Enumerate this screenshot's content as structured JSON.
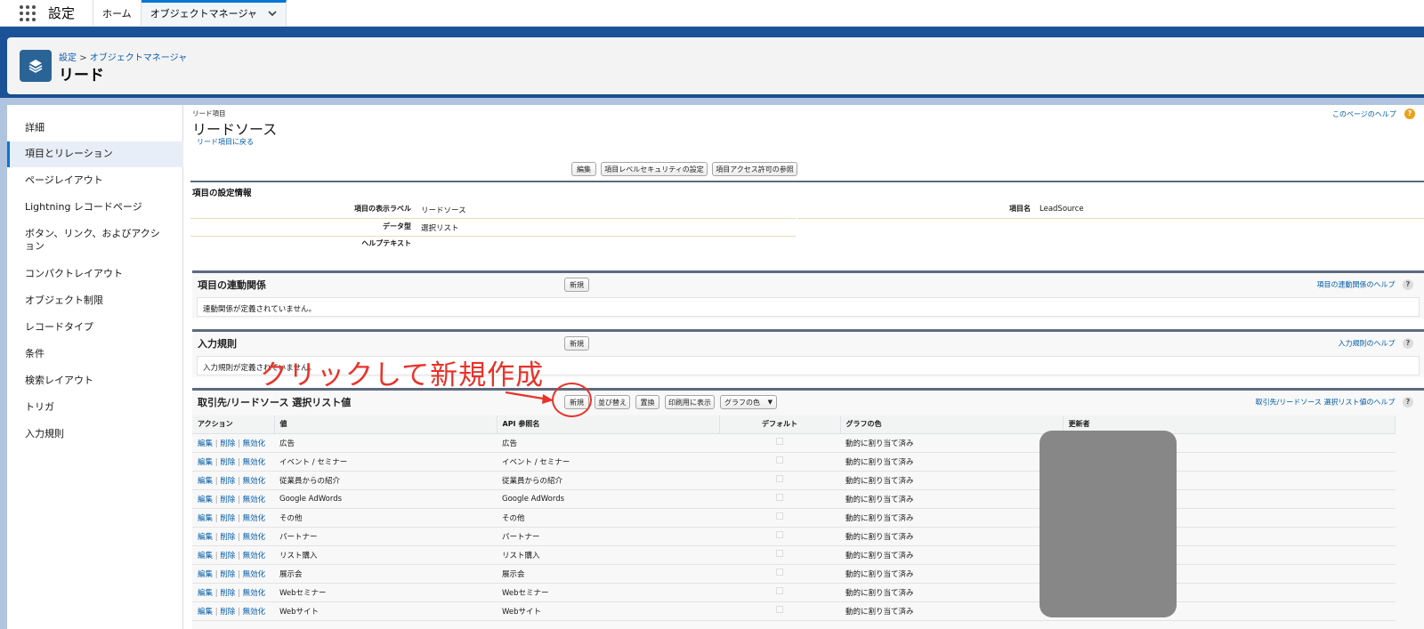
{
  "nav": {
    "app_name": "設定",
    "home_tab": "ホーム",
    "object_tab": "オブジェクトマネージャ"
  },
  "header": {
    "crumb_setup": "設定",
    "crumb_sep": ">",
    "crumb_object_manager": "オブジェクトマネージャ",
    "title": "リード"
  },
  "sidebar": {
    "items": [
      {
        "label": "詳細"
      },
      {
        "label": "項目とリレーション"
      },
      {
        "label": "ページレイアウト"
      },
      {
        "label": "Lightning レコードページ"
      },
      {
        "label": "ボタン、リンク、およびアクション"
      },
      {
        "label": "コンパクトレイアウト"
      },
      {
        "label": "オブジェクト制限"
      },
      {
        "label": "レコードタイプ"
      },
      {
        "label": "条件"
      },
      {
        "label": "検索レイアウト"
      },
      {
        "label": "トリガ"
      },
      {
        "label": "入力規則"
      }
    ]
  },
  "field": {
    "section_label": "リード項目",
    "title": "リードソース",
    "back_link": "リード項目に戻る",
    "page_help": "このページのヘルプ",
    "buttons": {
      "edit": "編集",
      "fls": "項目レベルセキュリティの設定",
      "access": "項目アクセス許可の参照"
    },
    "info_title": "項目の設定情報",
    "label_caption": "項目の表示ラベル",
    "label_value": "リードソース",
    "name_caption": "項目名",
    "name_value": "LeadSource",
    "type_caption": "データ型",
    "type_value": "選択リスト",
    "help_caption": "ヘルプテキスト"
  },
  "dependencies": {
    "title": "項目の連動関係",
    "new_button": "新規",
    "help": "項目の連動関係のヘルプ",
    "empty": "連動関係が定義されていません。"
  },
  "validation": {
    "title": "入力規則",
    "new_button": "新規",
    "help": "入力規則のヘルプ",
    "empty": "入力規則が定義されていません。"
  },
  "picklist": {
    "title": "取引先/リードソース 選択リスト値",
    "buttons": {
      "new": "新規",
      "reorder": "並び替え",
      "replace": "置換",
      "print": "印刷用に表示",
      "chart_color": "グラフの色"
    },
    "help": "取引先/リードソース 選択リスト値のヘルプ",
    "columns": [
      "アクション",
      "値",
      "API 参照名",
      "デフォルト",
      "グラフの色",
      "更新者"
    ],
    "actions": {
      "edit": "編集",
      "delete": "削除",
      "deactivate": "無効化"
    },
    "rows": [
      {
        "value": "広告",
        "api": "広告",
        "color": "動的に割り当て済み"
      },
      {
        "value": "イベント / セミナー",
        "api": "イベント / セミナー",
        "color": "動的に割り当て済み"
      },
      {
        "value": "従業員からの紹介",
        "api": "従業員からの紹介",
        "color": "動的に割り当て済み"
      },
      {
        "value": "Google AdWords",
        "api": "Google AdWords",
        "color": "動的に割り当て済み"
      },
      {
        "value": "その他",
        "api": "その他",
        "color": "動的に割り当て済み"
      },
      {
        "value": "パートナー",
        "api": "パートナー",
        "color": "動的に割り当て済み"
      },
      {
        "value": "リスト購入",
        "api": "リスト購入",
        "color": "動的に割り当て済み"
      },
      {
        "value": "展示会",
        "api": "展示会",
        "color": "動的に割り当て済み"
      },
      {
        "value": "Webセミナー",
        "api": "Webセミナー",
        "color": "動的に割り当て済み"
      },
      {
        "value": "Webサイト",
        "api": "Webサイト",
        "color": "動的に割り当て済み"
      }
    ]
  },
  "annotation": {
    "text": "クリックして新規作成",
    "color": "#e8332a"
  },
  "colors": {
    "brand_band": "#1b5297",
    "link": "#015ba7",
    "icon_tile": "#2a6496"
  }
}
